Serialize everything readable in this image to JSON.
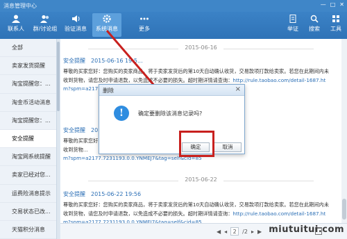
{
  "window": {
    "title": "消息管理中心",
    "controls": [
      "—",
      "□",
      "✕"
    ]
  },
  "toolbar": {
    "items": [
      {
        "label": "联系人",
        "icon": "contacts-icon"
      },
      {
        "label": "群/讨论组",
        "icon": "group-icon"
      },
      {
        "label": "验证消息",
        "icon": "speaker-icon"
      },
      {
        "label": "系统消息",
        "icon": "gear-icon"
      },
      {
        "label": "更多",
        "icon": "more-icon"
      }
    ],
    "right_items": [
      {
        "label": "举证",
        "icon": "document-icon"
      },
      {
        "label": "搜索",
        "icon": "search-icon"
      },
      {
        "label": "工具",
        "icon": "tools-icon"
      }
    ]
  },
  "sidebar": {
    "items": [
      {
        "label": "全部"
      },
      {
        "label": "卖家发货提醒"
      },
      {
        "label": "淘宝提醒您：..."
      },
      {
        "label": "淘金币活动消息"
      },
      {
        "label": "淘宝提醒您：..."
      },
      {
        "label": "安全提醒"
      },
      {
        "label": "淘宝网系统提醒"
      },
      {
        "label": "卖家已经对您..."
      },
      {
        "label": "运费险消息提示"
      },
      {
        "label": "交易状态已改..."
      },
      {
        "label": "天猫积分消息"
      }
    ],
    "active_index": 5
  },
  "messages": [
    {
      "date": "2015-06-16",
      "title": "安全提醒",
      "time": "2015-06-16 19:5...",
      "body": "尊敬的买家您好：您购买的卖家商品，将于卖家发货后的第10天自动确认收货，交易款项打款给卖家。若您在此期间内未\n收到货物，请您及时申请退款，以免造成不必要的损失。超时期详情请查询：",
      "link": "http://rule.taobao.com/detail-1687.ht\nm?spm=a2177..."
    },
    {
      "date": "",
      "title": "安全提醒",
      "time": "2015-06-...",
      "body": "尊敬的买家您好...\n收到货物...",
      "link": "m?spm=a2177.7231193.0.0.YNMEJ7&tag=self&cid=85"
    },
    {
      "date": "2015-06-22",
      "title": "安全提醒",
      "time": "2015-06-22 19:56",
      "body": "尊敬的买家您好：您购买的卖家商品，将于卖家发货后的第10天自动确认收货，交易款项打款给卖家。若您在此期间内未\n收到货物，请您及时申请退款，以免造成不必要的损失。超时期详情请查询：",
      "link": "http://rule.taobao.com/detail-1687.ht\nm?spm=a2177.7231193.0.0.YNMEJ7&tag=self&cid=85"
    }
  ],
  "pager": {
    "first": "◀",
    "prev": "◂",
    "current": "2",
    "total": "/2",
    "next": "▸",
    "last": "▶"
  },
  "dialog": {
    "title": "删除",
    "close": "×",
    "icon_text": "!",
    "message": "确定要删除该消息记录吗?",
    "ok_label": "确定",
    "cancel_label": "取消"
  },
  "watermark": "miutuitui.com",
  "colors": {
    "accent": "#2f73b7",
    "highlight": "#c8201e",
    "link": "#2a6eb5"
  }
}
